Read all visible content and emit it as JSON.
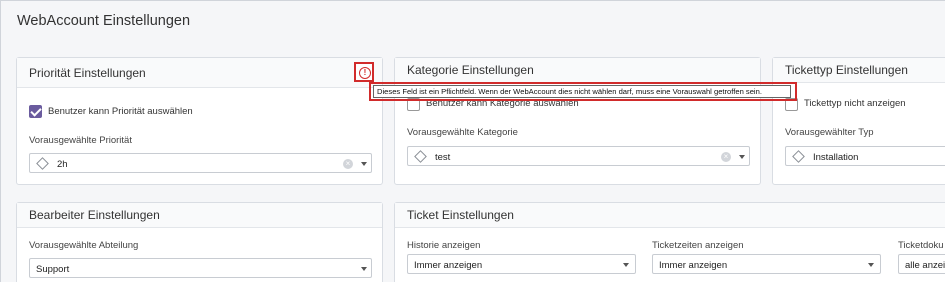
{
  "page": {
    "title": "WebAccount Einstellungen"
  },
  "priority": {
    "header": "Priorität Einstellungen",
    "checkbox_label": "Benutzer kann Priorität auswählen",
    "checkbox_checked": true,
    "select_label": "Vorausgewählte Priorität",
    "select_value": "2h"
  },
  "category": {
    "header": "Kategorie Einstellungen",
    "checkbox_label": "Benutzer kann Kategorie auswählen",
    "checkbox_checked": false,
    "select_label": "Vorausgewählte Kategorie",
    "select_value": "test"
  },
  "tickettype": {
    "header": "Tickettyp Einstellungen",
    "checkbox_label": "Tickettyp nicht anzeigen",
    "checkbox_checked": false,
    "select_label": "Vorausgewählter Typ",
    "select_value": "Installation"
  },
  "editor": {
    "header": "Bearbeiter Einstellungen",
    "select_label": "Vorausgewählte Abteilung",
    "select_value": "Support"
  },
  "ticket": {
    "header": "Ticket Einstellungen",
    "history_label": "Historie anzeigen",
    "history_value": "Immer anzeigen",
    "times_label": "Ticketzeiten anzeigen",
    "times_value": "Immer anzeigen",
    "docs_label": "Ticketdoku",
    "docs_value": "alle anzei"
  },
  "tooltip": {
    "text": "Dieses Feld ist ein Pflichtfeld. Wenn der WebAccount dies nicht wählen darf, muss eine Vorauswahl getroffen sein.",
    "icon_glyph": "!"
  },
  "colors": {
    "accent": "#6a5b9e",
    "warning": "#d12b2b"
  }
}
